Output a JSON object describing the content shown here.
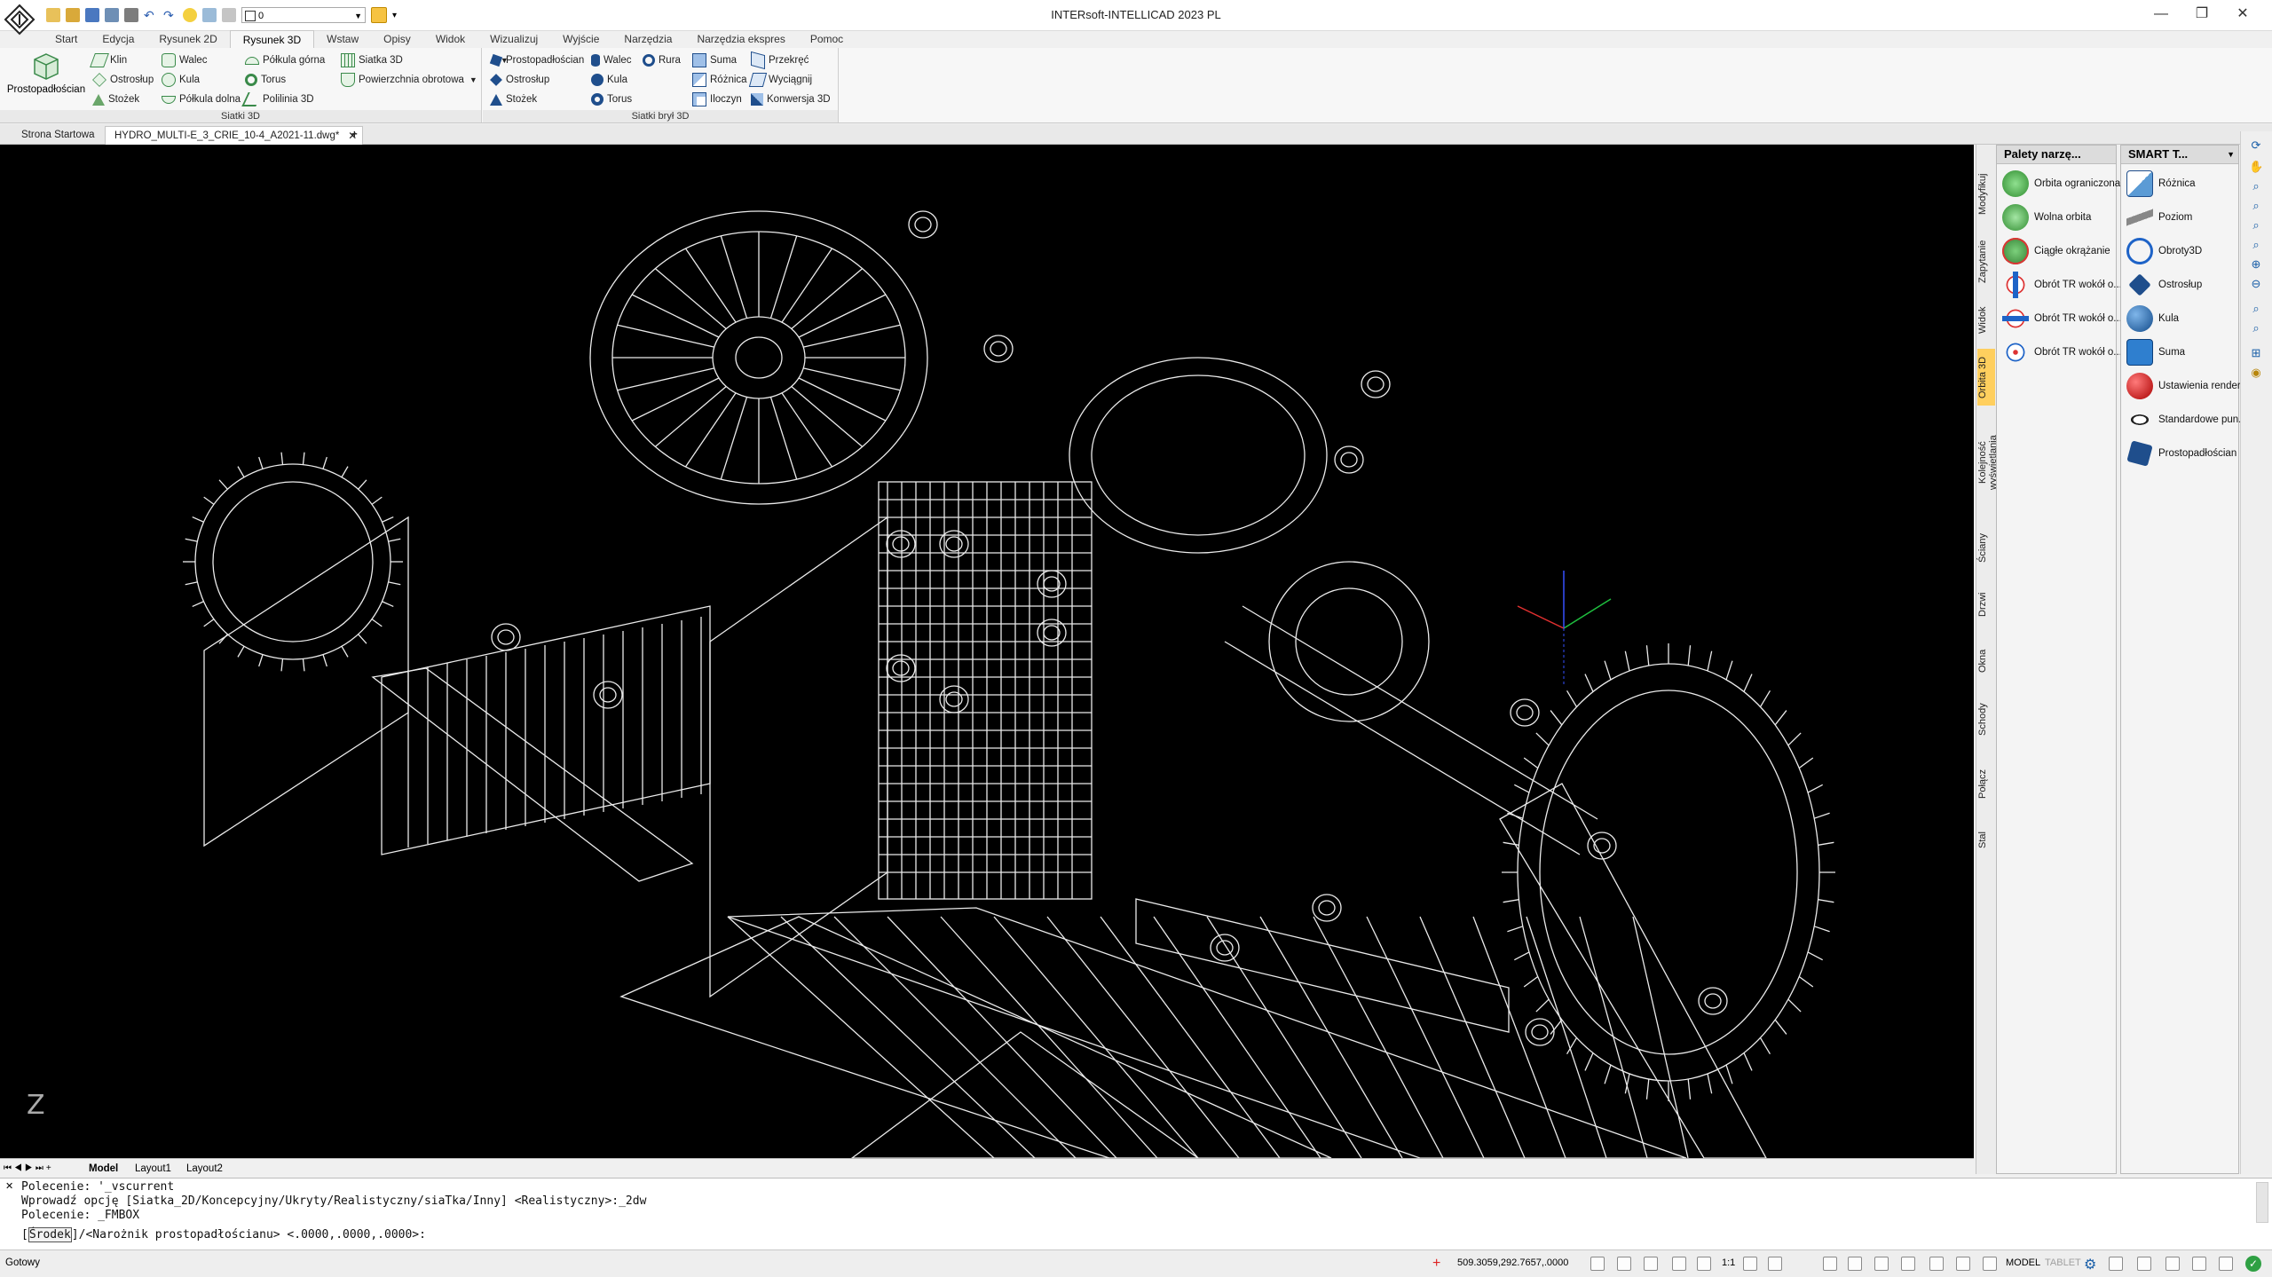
{
  "window": {
    "title": "INTERsoft-INTELLICAD 2023 PL",
    "layer_value": "0"
  },
  "ribbon_tabs": [
    "Start",
    "Edycja",
    "Rysunek 2D",
    "Rysunek 3D",
    "Wstaw",
    "Opisy",
    "Widok",
    "Wizualizuj",
    "Wyjście",
    "Narzędzia",
    "Narzędzia ekspres",
    "Pomoc"
  ],
  "ribbon": {
    "solids3d": {
      "title": "Siatki 3D",
      "big_button": "Prostopadłościan",
      "col1": [
        "Klin",
        "Ostrosłup",
        "Stożek"
      ],
      "col2": [
        "Walec",
        "Kula",
        "Półkula dolna"
      ],
      "col3": [
        "Półkula górna",
        "Torus",
        "Polilinia 3D"
      ],
      "col4": [
        "Siatka 3D",
        "Powierzchnia obrotowa"
      ]
    },
    "meshes": {
      "title": "Siatki brył 3D",
      "col1": [
        "Prostopadłościan",
        "Ostrosłup",
        "Stożek"
      ],
      "col2": [
        "Walec",
        "Kula",
        "Torus"
      ],
      "col2b": [
        "Rura"
      ],
      "col3": [
        "Suma",
        "Różnica",
        "Iloczyn"
      ],
      "col4": [
        "Przekręć",
        "Wyciągnij",
        "Konwersja 3D"
      ]
    }
  },
  "doc_tabs": {
    "start": "Strona Startowa",
    "active": "HYDRO_MULTI-E_3_CRIE_10-4_A2021-11.dwg*",
    "add": "+"
  },
  "layout_tabs": [
    "Model",
    "Layout1",
    "Layout2"
  ],
  "vertical_tabs": [
    "Modyfikuj",
    "Zapytanie",
    "Widok",
    "Orbita 3D",
    "Kolejność wyświetlania",
    "Ściany",
    "Drzwi",
    "Okna",
    "Schody",
    "Połącz",
    "Stal"
  ],
  "palette_tools": {
    "title": "Palety narzę...",
    "items": [
      "Orbita ograniczona",
      "Wolna orbita",
      "Ciągłe okrążanie",
      "Obrót TR wokół o...",
      "Obrót TR wokół o...",
      "Obrót TR wokół o..."
    ]
  },
  "palette_smart": {
    "title": "SMART T...",
    "items": [
      "Różnica",
      "Poziom",
      "Obroty3D",
      "Ostrosłup",
      "Kula",
      "Suma",
      "Ustawienia render...",
      "Standardowe pun...",
      "Prostopadłościan"
    ]
  },
  "viewport": {
    "axis_z_label": "Z"
  },
  "command": {
    "history": [
      "Polecenie: '_vscurrent",
      "Wprowadź opcję [Siatka_2D/Koncepcyjny/Ukryty/Realistyczny/siaTka/Inny] <Realistyczny>:_2dw",
      "Polecenie: _FMBOX"
    ],
    "prompt_bracket": "[",
    "prompt_option": "Środek",
    "prompt_rest": "]/<Narożnik prostopadłościanu> <.0000,.0000,.0000>:"
  },
  "status": {
    "ready": "Gotowy",
    "coords": "509.3059,292.7657,.0000",
    "scale": "1:1",
    "model": "MODEL",
    "tablet": "TABLET"
  },
  "colors": {
    "accent": "#1a5fa8",
    "active_vtab": "#ffcf5e",
    "canvas": "#000000"
  }
}
